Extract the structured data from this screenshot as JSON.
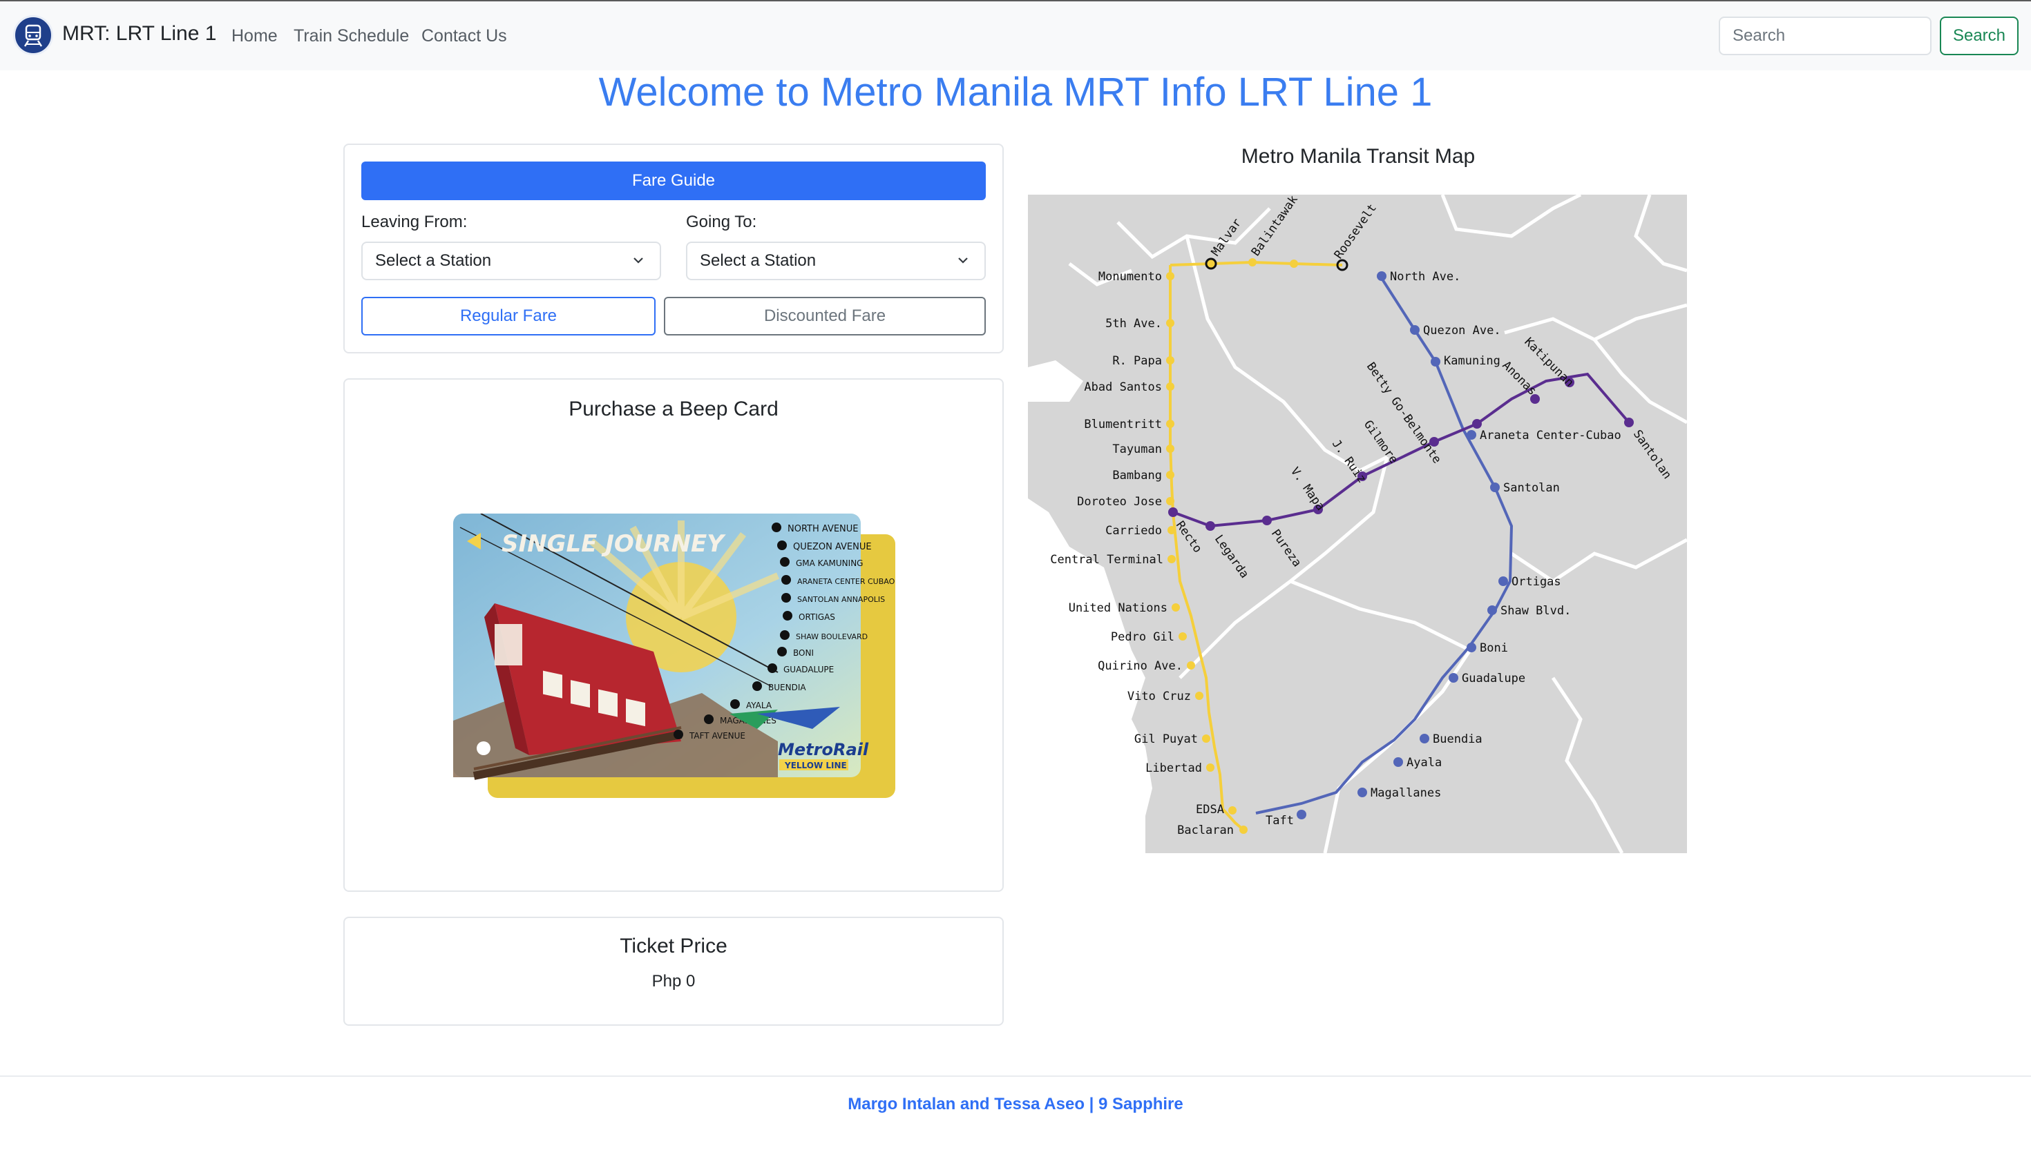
{
  "navbar": {
    "brand": "MRT: LRT Line 1",
    "links": [
      "Home",
      "Train Schedule",
      "Contact Us"
    ],
    "search_placeholder": "Search",
    "search_button": "Search"
  },
  "page_title": "Welcome to Metro Manila MRT Info LRT Line 1",
  "fare_guide": {
    "button": "Fare Guide",
    "leaving_label": "Leaving From:",
    "going_label": "Going To:",
    "leaving_value": "Select a Station",
    "going_value": "Select a Station",
    "regular_button": "Regular Fare",
    "discounted_button": "Discounted Fare"
  },
  "beep_card": {
    "heading": "Purchase a Beep Card",
    "card_title": "SINGLE JOURNEY",
    "card_stations": [
      "NORTH AVENUE",
      "QUEZON AVENUE",
      "GMA KAMUNING",
      "ARANETA CENTER CUBAO",
      "SANTOLAN ANNAPOLIS",
      "ORTIGAS",
      "SHAW BOULEVARD",
      "BONI",
      "GUADALUPE",
      "BUENDIA",
      "AYALA",
      "MAGALLANES",
      "TAFT AVENUE"
    ],
    "card_brand": "MetroRail",
    "card_line": "YELLOW LINE"
  },
  "ticket": {
    "heading": "Ticket Price",
    "price": "Php 0"
  },
  "map": {
    "title": "Metro Manila Transit Map",
    "line1_stations": [
      "Monumento",
      "5th Ave.",
      "R. Papa",
      "Abad Santos",
      "Blumentritt",
      "Tayuman",
      "Bambang",
      "Doroteo Jose",
      "Carriedo",
      "Central Terminal",
      "United Nations",
      "Pedro Gil",
      "Quirino Ave.",
      "Vito Cruz",
      "Gil Puyat",
      "Libertad",
      "EDSA",
      "Baclaran"
    ],
    "line1_north_stations": [
      "Malvar",
      "Balintawak",
      "Roosevelt"
    ],
    "line2_stations": [
      "Recto",
      "Legarda",
      "Pureza",
      "V. Mapa",
      "J. Ruiz",
      "Gilmore",
      "Betty Go-Belmonte",
      "Anonas",
      "Katipunan",
      "Santolan"
    ],
    "line3_stations": [
      "North Ave.",
      "Quezon Ave.",
      "Kamuning",
      "Araneta Center-Cubao",
      "Santolan",
      "Ortigas",
      "Shaw Blvd.",
      "Boni",
      "Guadalupe",
      "Buendia",
      "Ayala",
      "Magallanes",
      "Taft"
    ],
    "colors": {
      "line1": "#f5cf3c",
      "line2": "#5a2d8f",
      "line3": "#5366b8",
      "land": "#d6d6d6",
      "boundary": "#ffffff"
    }
  },
  "footer": {
    "text": "Margo Intalan and Tessa Aseo | 9 Sapphire"
  },
  "theme": {
    "primary": "#2f6ff5",
    "title": "#3a7df0",
    "success": "#198754"
  }
}
